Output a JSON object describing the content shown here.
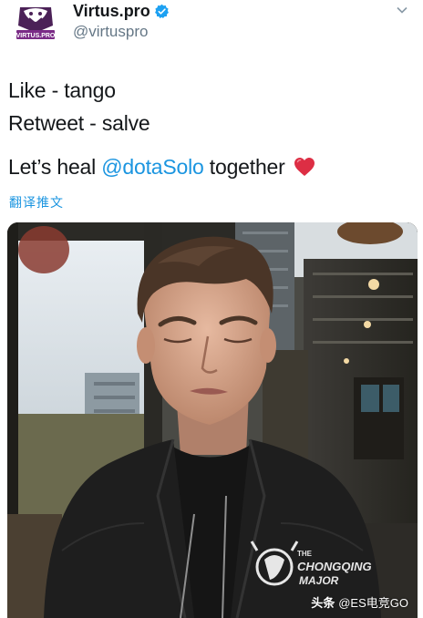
{
  "account": {
    "display_name": "Virtus.pro",
    "handle": "@virtuspro",
    "avatar_text": "VIRTUS.PRO",
    "verified": true,
    "accent_color": "#7a2b86"
  },
  "tweet": {
    "line1": "Like - tango",
    "line2": "Retweet - salve",
    "line3_before": "Let’s heal ",
    "line3_mention": "@dotaSolo",
    "line3_after": " together",
    "emoji": "heart-emoji",
    "translate_label": "翻译推文",
    "mention_color": "#1b95e0"
  },
  "photo": {
    "jacket_print": [
      "THE",
      "CHONGQING",
      "MAJOR"
    ]
  },
  "watermark": {
    "prefix": "头条",
    "text": "@ES电竞GO"
  }
}
